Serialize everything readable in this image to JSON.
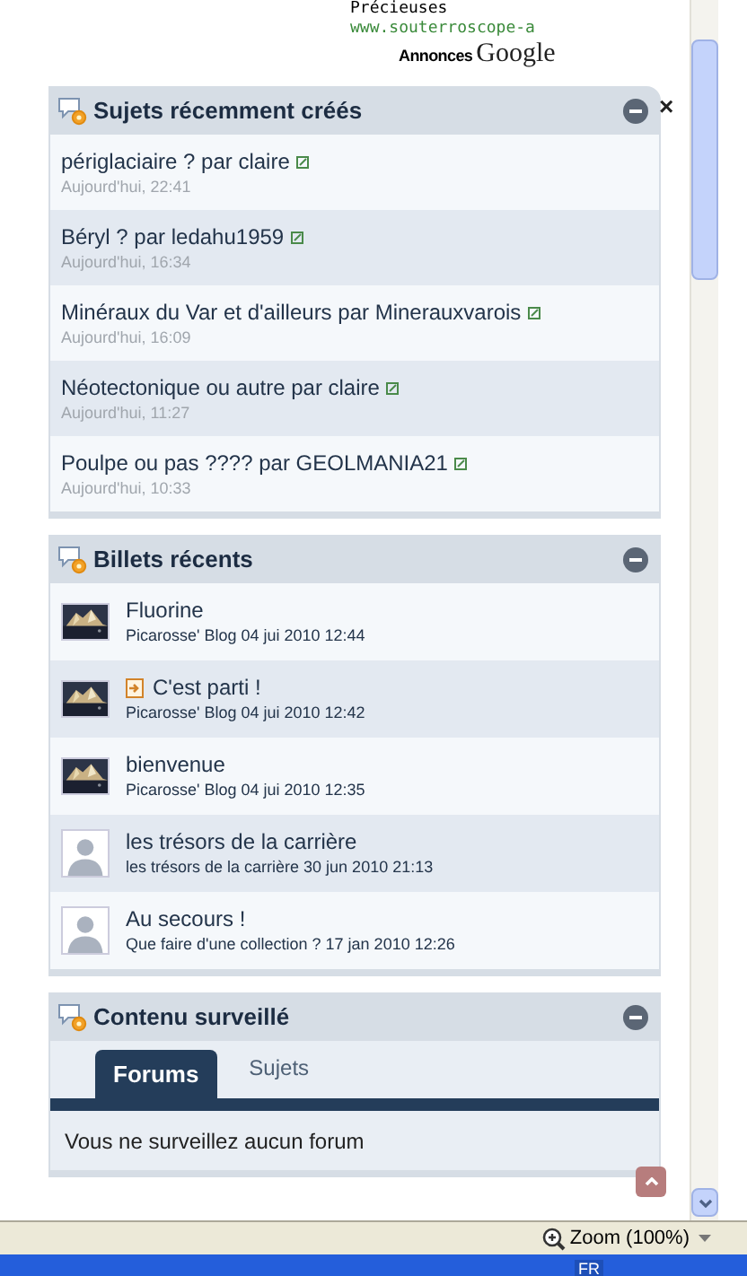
{
  "ad": {
    "title": "Précieuses",
    "url": "www.souterroscope-a",
    "label": "Annonces",
    "brand": "Google"
  },
  "panels": [
    {
      "title": "Sujets récemment créés",
      "kind": "topics",
      "close_label": "×",
      "items": [
        {
          "title": "périglaciaire ? par claire",
          "date": "Aujourd'hui, 22:41"
        },
        {
          "title": "Béryl ? par ledahu1959",
          "date": "Aujourd'hui, 16:34"
        },
        {
          "title": "Minéraux du Var et d'ailleurs par Minerauxvarois",
          "date": "Aujourd'hui, 16:09"
        },
        {
          "title": "Néotectonique ou autre par claire",
          "date": "Aujourd'hui, 11:27"
        },
        {
          "title": "Poulpe ou pas ???? par GEOLMANIA21",
          "date": "Aujourd'hui, 10:33"
        }
      ]
    },
    {
      "title": "Billets récents",
      "kind": "posts",
      "items": [
        {
          "title": "Fluorine",
          "meta": "Picarosse' Blog 04 jui 2010 12:44",
          "feed_icon": false
        },
        {
          "title": "C'est parti !",
          "meta": "Picarosse' Blog 04 jui 2010 12:42",
          "feed_icon": true
        },
        {
          "title": "bienvenue",
          "meta": "Picarosse' Blog 04 jui 2010 12:35",
          "feed_icon": false
        },
        {
          "title": "les trésors de la carrière",
          "meta": "les trésors de la carrière 30 jun 2010 21:13",
          "kind": "default",
          "feed_icon": false
        },
        {
          "title": "Au secours !",
          "meta": "Que faire d'une collection ? 17 jan 2010 12:26",
          "kind": "default",
          "feed_icon": false
        }
      ]
    },
    {
      "title": "Contenu surveillé",
      "kind": "watched",
      "tabs": [
        {
          "label": "Forums",
          "selected": true
        },
        {
          "label": "Sujets",
          "selected": false
        }
      ],
      "message": "Vous ne surveillez aucun forum"
    }
  ],
  "status_bar": {
    "zoom": "Zoom (100%)"
  },
  "taskbar": {
    "language": "FR"
  }
}
